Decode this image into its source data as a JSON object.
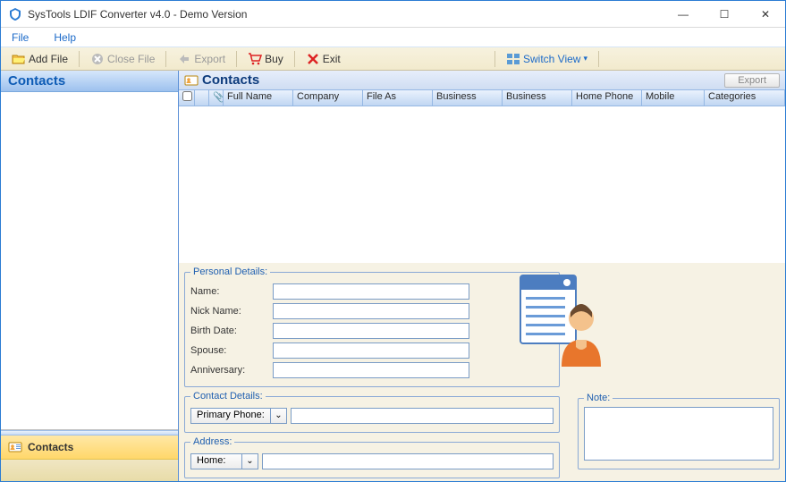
{
  "window": {
    "title": "SysTools LDIF Converter v4.0 - Demo Version"
  },
  "menu": {
    "file": "File",
    "help": "Help"
  },
  "toolbar": {
    "add_file": "Add File",
    "close_file": "Close File",
    "export": "Export",
    "buy": "Buy",
    "exit": "Exit",
    "switch_view": "Switch View"
  },
  "left": {
    "header": "Contacts",
    "nav_contacts": "Contacts"
  },
  "grid": {
    "title": "Contacts",
    "export_btn": "Export",
    "columns": [
      "",
      "",
      "",
      "Full Name",
      "Company",
      "File As",
      "Business",
      "Business",
      "Home Phone",
      "Mobile",
      "Categories"
    ]
  },
  "details": {
    "personal": {
      "legend": "Personal Details:",
      "name": "Name:",
      "nick": "Nick Name:",
      "birth": "Birth Date:",
      "spouse": "Spouse:",
      "anniv": "Anniversary:"
    },
    "contact": {
      "legend": "Contact Details:",
      "primary_phone": "Primary Phone:"
    },
    "address": {
      "legend": "Address:",
      "home": "Home:"
    },
    "note": {
      "legend": "Note:"
    }
  }
}
